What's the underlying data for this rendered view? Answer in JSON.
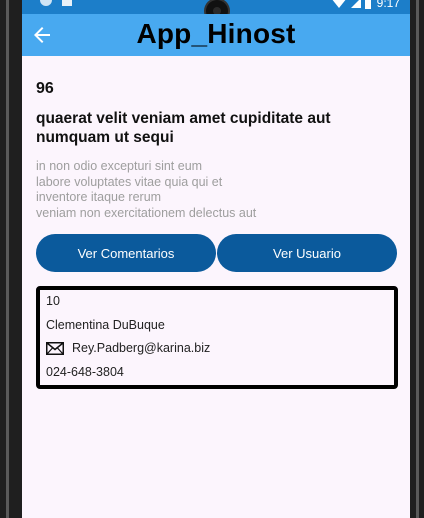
{
  "status_bar": {
    "time": "9:17"
  },
  "app_bar": {
    "title": "App_Hinost",
    "back_icon": "arrow-left-icon"
  },
  "post": {
    "id": "96",
    "title": "quaerat velit veniam amet cupiditate aut numquam ut sequi",
    "body_lines": [
      "in non odio excepturi sint eum",
      "labore voluptates vitae quia qui et",
      "inventore itaque rerum",
      "veniam non exercitationem delectus aut"
    ]
  },
  "buttons": {
    "comments_label": "Ver Comentarios",
    "user_label": "Ver Usuario"
  },
  "user": {
    "id": "10",
    "name": "Clementina DuBuque",
    "email": "Rey.Padberg@karina.biz",
    "email_icon": "envelope-icon",
    "phone": "024-648-3804"
  },
  "colors": {
    "app_bar": "#48a9f0",
    "status_bar": "#1c7ec9",
    "button": "#0b5a9c",
    "background": "#fcf5fd"
  }
}
